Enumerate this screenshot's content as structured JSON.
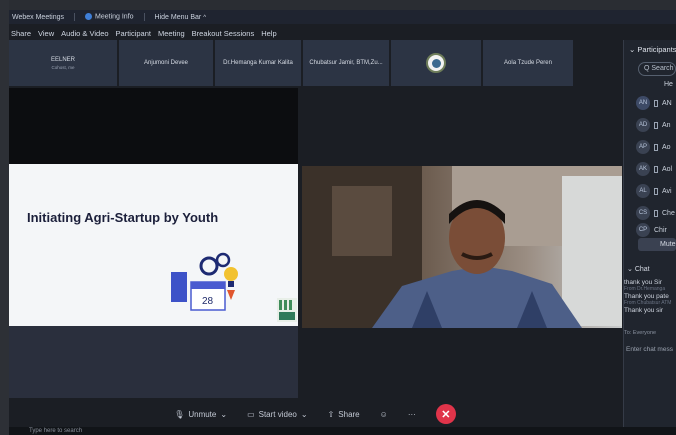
{
  "titlebar": {
    "app_name": "Webex Meetings",
    "meeting_info": "Meeting Info",
    "hide_menu": "Hide Menu Bar"
  },
  "menu": [
    "Share",
    "View",
    "Audio & Video",
    "Participant",
    "Meeting",
    "Breakout Sessions",
    "Help"
  ],
  "participants_strip": [
    {
      "name": "EELNER",
      "sub": "Cohost, me"
    },
    {
      "name": "Anjumoni Devee",
      "sub": ""
    },
    {
      "name": "Dr.Hemanga Kumar Kalita",
      "sub": ""
    },
    {
      "name": "Chubatsur Jamir, BTM,Zu...",
      "sub": ""
    },
    {
      "name": "",
      "sub": ""
    },
    {
      "name": "Aola Tzude Peren",
      "sub": ""
    }
  ],
  "slide": {
    "title": "Initiating Agri-Startup by Youth",
    "calendar_number": "28"
  },
  "controls": {
    "unmute": "Unmute",
    "start_video": "Start video",
    "share": "Share",
    "more": "···",
    "end": "✕"
  },
  "taskbar": {
    "search_placeholder": "Type here to search"
  },
  "panel": {
    "header": "Participants",
    "search_placeholder": "Search",
    "first_row_text": "He",
    "participants": [
      {
        "initials": "AN",
        "name": "AN"
      },
      {
        "initials": "AD",
        "name": "An"
      },
      {
        "initials": "AP",
        "name": "Ao"
      },
      {
        "initials": "AK",
        "name": "Aol"
      },
      {
        "initials": "AL",
        "name": "Avi"
      },
      {
        "initials": "CS",
        "name": "Che"
      },
      {
        "initials": "CP",
        "name": "Chir"
      }
    ],
    "mute_all": "Mute",
    "chat_header": "Chat",
    "chat": [
      {
        "text": "thank you Sir",
        "meta": "From Dr.Hemanga"
      },
      {
        "text": "Thank you  pate",
        "meta": "From Chubatsur ATM"
      },
      {
        "text": "Thank you sir",
        "meta": ""
      }
    ],
    "chat_to": "To:   Everyone",
    "chat_input_placeholder": "Enter chat mess"
  },
  "colors": {
    "end_button": "#e0344a",
    "accent": "#3f7fd8"
  }
}
